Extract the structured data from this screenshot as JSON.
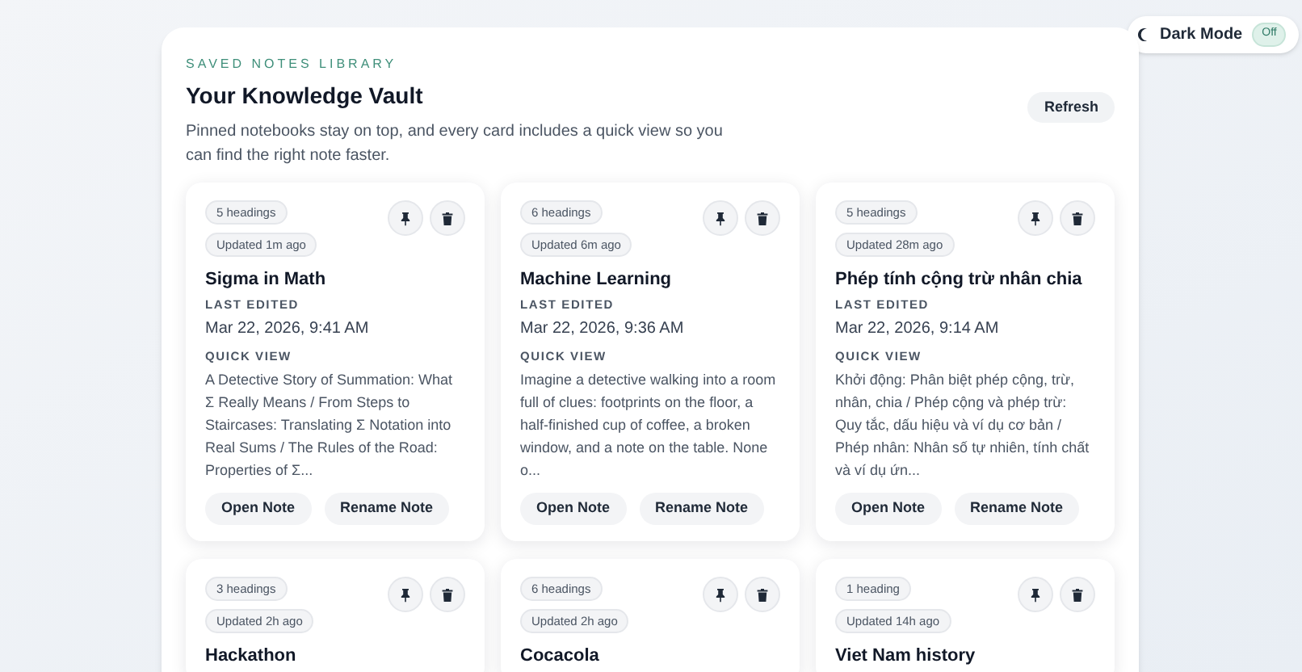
{
  "theme_toggle": {
    "label": "Dark Mode",
    "value": "Off",
    "on": false
  },
  "header": {
    "eyebrow": "SAVED NOTES LIBRARY",
    "title": "Your Knowledge Vault",
    "description": "Pinned notebooks stay on top, and every card includes a quick view so you can find the right note faster.",
    "refresh": "Refresh"
  },
  "notes": [
    {
      "headings": "5 headings",
      "updated": "Updated 1m ago",
      "title": "Sigma in Math",
      "last_edited_label": "LAST EDITED",
      "last_edited": "Mar 22, 2026, 9:41 AM",
      "quick_view_label": "QUICK VIEW",
      "preview": "A Detective Story of Summation: What Σ Really Means / From Steps to Staircases: Translating Σ Notation into Real Sums / The Rules of the Road: Properties of Σ...",
      "open": "Open Note",
      "rename": "Rename Note"
    },
    {
      "headings": "6 headings",
      "updated": "Updated 6m ago",
      "title": "Machine Learning",
      "last_edited_label": "LAST EDITED",
      "last_edited": "Mar 22, 2026, 9:36 AM",
      "quick_view_label": "QUICK VIEW",
      "preview": "Imagine a detective walking into a room full of clues: footprints on the floor, a half-finished cup of coffee, a broken window, and a note on the table. None o...",
      "open": "Open Note",
      "rename": "Rename Note"
    },
    {
      "headings": "5 headings",
      "updated": "Updated 28m ago",
      "title": "Phép tính cộng trừ nhân chia",
      "last_edited_label": "LAST EDITED",
      "last_edited": "Mar 22, 2026, 9:14 AM",
      "quick_view_label": "QUICK VIEW",
      "preview": "Khởi động: Phân biệt phép cộng, trừ, nhân, chia / Phép cộng và phép trừ: Quy tắc, dấu hiệu và ví dụ cơ bản / Phép nhân: Nhân số tự nhiên, tính chất và ví dụ ứn...",
      "open": "Open Note",
      "rename": "Rename Note"
    },
    {
      "headings": "3 headings",
      "updated": "Updated 2h ago",
      "title": "Hackathon"
    },
    {
      "headings": "6 headings",
      "updated": "Updated 2h ago",
      "title": "Cocacola"
    },
    {
      "headings": "1 heading",
      "updated": "Updated 14h ago",
      "title": "Viet Nam history"
    }
  ]
}
